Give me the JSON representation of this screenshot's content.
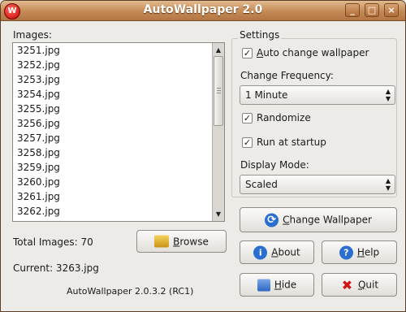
{
  "window": {
    "title": "AutoWallpaper 2.0",
    "icon_text": "W"
  },
  "images_label": "Images:",
  "images": [
    "3251.jpg",
    "3252.jpg",
    "3253.jpg",
    "3254.jpg",
    "3255.jpg",
    "3256.jpg",
    "3257.jpg",
    "3258.jpg",
    "3259.jpg",
    "3260.jpg",
    "3261.jpg",
    "3262.jpg"
  ],
  "total_label": "Total Images: 70",
  "current_label": "Current: 3263.jpg",
  "version": "AutoWallpaper 2.0.3.2 (RC1)",
  "settings": {
    "title": "Settings",
    "auto_change": {
      "label_first": "A",
      "label_rest": "uto change wallpaper",
      "checked": true
    },
    "frequency_label": "Change Frequency:",
    "frequency_value": "1 Minute",
    "randomize": {
      "label": "Randomize",
      "checked": true
    },
    "startup": {
      "label": "Run at startup",
      "checked": true
    },
    "display_label": "Display Mode:",
    "display_value": "Scaled"
  },
  "buttons": {
    "browse": {
      "u": "B",
      "rest": "rowse"
    },
    "change": {
      "u": "C",
      "rest": "hange Wallpaper"
    },
    "about": {
      "u": "A",
      "rest": "bout"
    },
    "help": {
      "u": "H",
      "rest": "elp"
    },
    "hide": {
      "u": "H",
      "rest": "ide"
    },
    "quit": {
      "u": "Q",
      "rest": "uit"
    }
  },
  "colors": {
    "titlebar": "#c48a55",
    "accent_blue": "#2a6fd0",
    "quit_red": "#d21414"
  }
}
